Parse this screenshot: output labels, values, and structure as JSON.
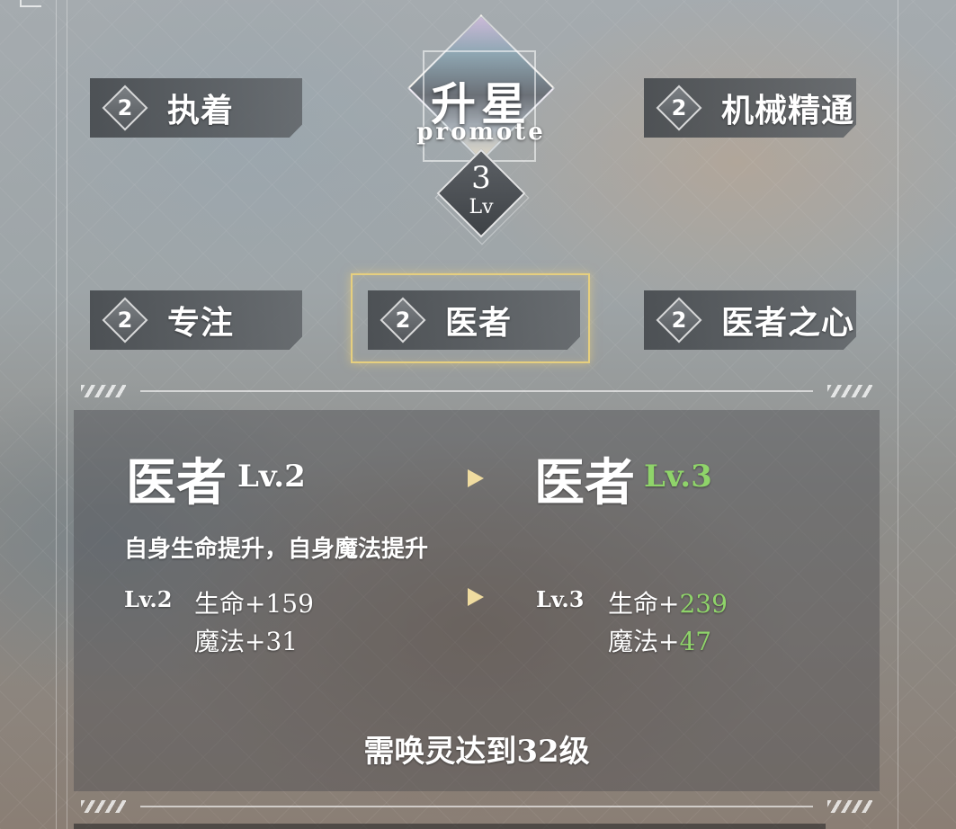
{
  "emblem": {
    "title": "升星",
    "subtitle": "promote",
    "level": "3",
    "level_label": "Lv"
  },
  "nodes": [
    {
      "rank": "2",
      "name": "执着"
    },
    {
      "rank": "2",
      "name": "机械精通"
    },
    {
      "rank": "2",
      "name": "专注"
    },
    {
      "rank": "2",
      "name": "医者"
    },
    {
      "rank": "2",
      "name": "医者之心"
    }
  ],
  "selected_node": 3,
  "detail": {
    "current_name": "医者",
    "current_level": "Lv.2",
    "next_name": "医者",
    "next_level": "Lv.3",
    "description": "自身生命提升，自身魔法提升",
    "current_stats": {
      "level": "Lv.2",
      "hp_label": "生命",
      "hp_value": "+159",
      "mp_label": "魔法",
      "mp_value": "+31"
    },
    "next_stats": {
      "level": "Lv.3",
      "hp_label": "生命+",
      "hp_value": "239",
      "mp_label": "魔法+",
      "mp_value": "47"
    },
    "requirement": "需唤灵达到32级"
  },
  "colors": {
    "highlight_green": "#8fd46a",
    "selected_frame": "#e6cf7f",
    "arrow": "#f0dca0"
  }
}
